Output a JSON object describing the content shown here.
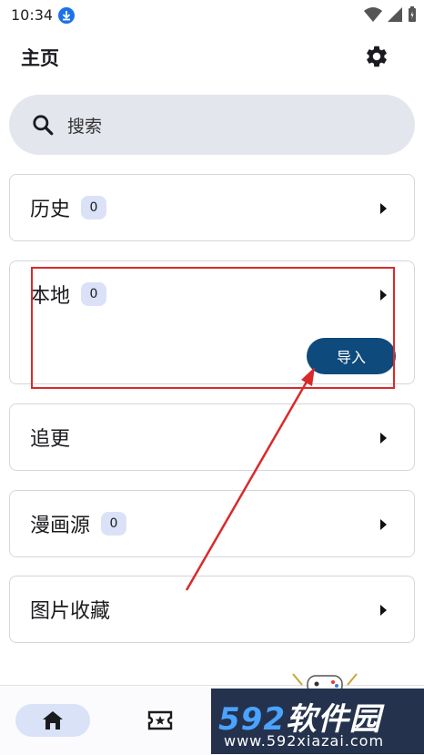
{
  "status_bar": {
    "time": "10:34"
  },
  "header": {
    "title": "主页"
  },
  "search": {
    "placeholder": "搜索"
  },
  "cards": [
    {
      "label": "历史",
      "count": "0"
    },
    {
      "label": "本地",
      "count": "0",
      "action_label": "导入"
    },
    {
      "label": "追更"
    },
    {
      "label": "漫画源",
      "count": "0"
    },
    {
      "label": "图片收藏"
    }
  ],
  "bottom_nav": {
    "items": [
      "home-icon",
      "ticket-star-icon"
    ]
  },
  "watermark": {
    "brand_num": "592",
    "brand_text": "软件园",
    "url": "www.592xiazai.com"
  },
  "annotation": {
    "highlight_color": "#d92a2a"
  },
  "colors": {
    "accent": "#0e4a7b",
    "badge_bg": "#dbe2f7",
    "search_bg": "#e4e6ee"
  }
}
